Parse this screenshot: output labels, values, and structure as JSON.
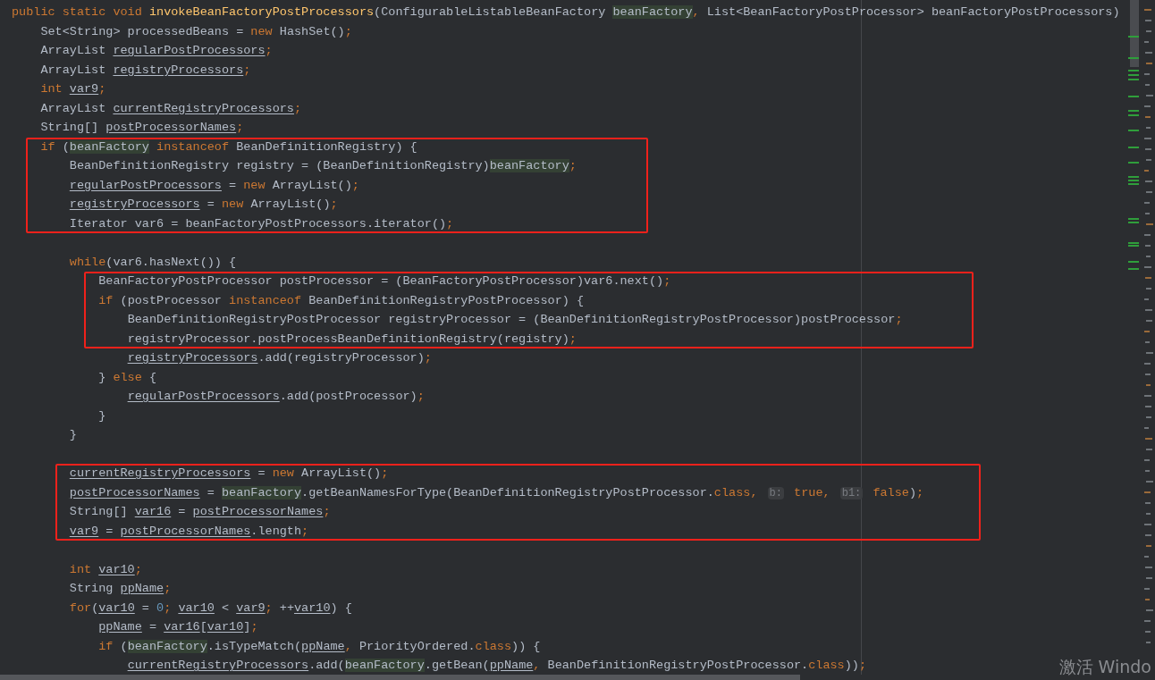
{
  "editor": {
    "blocks": [
      {
        "highlighted": false,
        "lines": [
          {
            "kind": "code",
            "tokens": [
              {
                "text": "public static void ",
                "kind": "keyword"
              },
              {
                "text": "invokeBeanFactoryPostProcessors",
                "kind": "method"
              },
              {
                "text": "(ConfigurableListableBeanFactory ",
                "kind": "plain"
              },
              {
                "text": "beanFactory",
                "kind": "param"
              },
              {
                "text": ", ",
                "kind": "keyword"
              },
              {
                "text": "List<BeanFactoryPostProcessor> beanFactoryPostProcessors)",
                "kind": "plain"
              }
            ]
          },
          {
            "kind": "code",
            "tokens": [
              {
                "text": "    Set<String> processedBeans = ",
                "kind": "plain"
              },
              {
                "text": "new",
                "kind": "keyword"
              },
              {
                "text": " HashSet()",
                "kind": "plain"
              },
              {
                "text": ";",
                "kind": "keyword"
              }
            ]
          },
          {
            "kind": "code",
            "tokens": [
              {
                "text": "    ArrayList ",
                "kind": "plain"
              },
              {
                "text": "regularPostProcessors",
                "kind": "field"
              },
              {
                "text": ";",
                "kind": "keyword"
              }
            ]
          },
          {
            "kind": "code",
            "tokens": [
              {
                "text": "    ArrayList ",
                "kind": "plain"
              },
              {
                "text": "registryProcessors",
                "kind": "field"
              },
              {
                "text": ";",
                "kind": "keyword"
              }
            ]
          },
          {
            "kind": "code",
            "tokens": [
              {
                "text": "    int ",
                "kind": "keyword"
              },
              {
                "text": "var9",
                "kind": "field"
              },
              {
                "text": ";",
                "kind": "keyword"
              }
            ]
          },
          {
            "kind": "code",
            "tokens": [
              {
                "text": "    ArrayList ",
                "kind": "plain"
              },
              {
                "text": "currentRegistryProcessors",
                "kind": "field"
              },
              {
                "text": ";",
                "kind": "keyword"
              }
            ]
          },
          {
            "kind": "code",
            "tokens": [
              {
                "text": "    String[] ",
                "kind": "plain"
              },
              {
                "text": "postProcessorNames",
                "kind": "field"
              },
              {
                "text": ";",
                "kind": "keyword"
              }
            ]
          }
        ]
      },
      {
        "highlighted": true,
        "lines": [
          {
            "kind": "code",
            "tokens": [
              {
                "text": "    if",
                "kind": "keyword"
              },
              {
                "text": " (",
                "kind": "plain"
              },
              {
                "text": "beanFactory",
                "kind": "param"
              },
              {
                "text": " instanceof",
                "kind": "keyword"
              },
              {
                "text": " BeanDefinitionRegistry) {",
                "kind": "plain"
              }
            ]
          },
          {
            "kind": "code",
            "tokens": [
              {
                "text": "        BeanDefinitionRegistry registry = (BeanDefinitionRegistry)",
                "kind": "plain"
              },
              {
                "text": "beanFactory",
                "kind": "param"
              },
              {
                "text": ";",
                "kind": "keyword"
              }
            ]
          },
          {
            "kind": "code",
            "tokens": [
              {
                "text": "        regularPostProcessors",
                "kind": "field"
              },
              {
                "text": " = ",
                "kind": "plain"
              },
              {
                "text": "new",
                "kind": "keyword"
              },
              {
                "text": " ArrayList()",
                "kind": "plain"
              },
              {
                "text": ";",
                "kind": "keyword"
              }
            ]
          },
          {
            "kind": "code",
            "tokens": [
              {
                "text": "        registryProcessors",
                "kind": "field"
              },
              {
                "text": " = ",
                "kind": "plain"
              },
              {
                "text": "new",
                "kind": "keyword"
              },
              {
                "text": " ArrayList()",
                "kind": "plain"
              },
              {
                "text": ";",
                "kind": "keyword"
              }
            ]
          },
          {
            "kind": "code",
            "tokens": [
              {
                "text": "        Iterator var6 = beanFactoryPostProcessors.iterator()",
                "kind": "plain"
              },
              {
                "text": ";",
                "kind": "keyword"
              }
            ]
          }
        ]
      },
      {
        "highlighted": false,
        "lines": [
          {
            "kind": "blank"
          },
          {
            "kind": "code",
            "tokens": [
              {
                "text": "        while",
                "kind": "keyword"
              },
              {
                "text": "(var6.hasNext()) {",
                "kind": "plain"
              }
            ]
          }
        ]
      },
      {
        "highlighted": true,
        "lines": [
          {
            "kind": "code",
            "tokens": [
              {
                "text": "            BeanFactoryPostProcessor postProcessor = (BeanFactoryPostProcessor)var6.next()",
                "kind": "plain"
              },
              {
                "text": ";",
                "kind": "keyword"
              }
            ]
          },
          {
            "kind": "code",
            "tokens": [
              {
                "text": "            if",
                "kind": "keyword"
              },
              {
                "text": " (postProcessor ",
                "kind": "plain"
              },
              {
                "text": "instanceof",
                "kind": "keyword"
              },
              {
                "text": " BeanDefinitionRegistryPostProcessor) {",
                "kind": "plain"
              }
            ]
          },
          {
            "kind": "code",
            "tokens": [
              {
                "text": "                BeanDefinitionRegistryPostProcessor registryProcessor = (BeanDefinitionRegistryPostProcessor)postProcessor",
                "kind": "plain"
              },
              {
                "text": ";",
                "kind": "keyword"
              }
            ]
          },
          {
            "kind": "code",
            "tokens": [
              {
                "text": "                registryProcessor.postProcessBeanDefinitionRegistry(registry)",
                "kind": "plain"
              },
              {
                "text": ";",
                "kind": "keyword"
              }
            ]
          }
        ]
      },
      {
        "highlighted": false,
        "lines": [
          {
            "kind": "code",
            "tokens": [
              {
                "text": "                registryProcessors",
                "kind": "field"
              },
              {
                "text": ".add(registryProcessor)",
                "kind": "plain"
              },
              {
                "text": ";",
                "kind": "keyword"
              }
            ]
          },
          {
            "kind": "code",
            "tokens": [
              {
                "text": "            } ",
                "kind": "plain"
              },
              {
                "text": "else",
                "kind": "keyword"
              },
              {
                "text": " {",
                "kind": "plain"
              }
            ]
          },
          {
            "kind": "code",
            "tokens": [
              {
                "text": "                regularPostProcessors",
                "kind": "field"
              },
              {
                "text": ".add(postProcessor)",
                "kind": "plain"
              },
              {
                "text": ";",
                "kind": "keyword"
              }
            ]
          },
          {
            "kind": "code",
            "tokens": [
              {
                "text": "            }",
                "kind": "plain"
              }
            ]
          },
          {
            "kind": "code",
            "tokens": [
              {
                "text": "        }",
                "kind": "plain"
              }
            ]
          },
          {
            "kind": "blank"
          }
        ]
      },
      {
        "highlighted": true,
        "lines": [
          {
            "kind": "code",
            "tokens": [
              {
                "text": "        currentRegistryProcessors",
                "kind": "field"
              },
              {
                "text": " = ",
                "kind": "plain"
              },
              {
                "text": "new",
                "kind": "keyword"
              },
              {
                "text": " ArrayList()",
                "kind": "plain"
              },
              {
                "text": ";",
                "kind": "keyword"
              }
            ]
          },
          {
            "kind": "code",
            "tokens": [
              {
                "text": "        postProcessorNames",
                "kind": "field"
              },
              {
                "text": " = ",
                "kind": "plain"
              },
              {
                "text": "beanFactory",
                "kind": "param"
              },
              {
                "text": ".getBeanNamesForType(BeanDefinitionRegistryPostProcessor.",
                "kind": "plain"
              },
              {
                "text": "class",
                "kind": "keyword"
              },
              {
                "text": ", ",
                "kind": "keyword"
              },
              {
                "text": "b:",
                "kind": "hint"
              },
              {
                "text": " true",
                "kind": "keyword"
              },
              {
                "text": ", ",
                "kind": "keyword"
              },
              {
                "text": "b1:",
                "kind": "hint"
              },
              {
                "text": " false",
                "kind": "keyword"
              },
              {
                "text": ")",
                "kind": "plain"
              },
              {
                "text": ";",
                "kind": "keyword"
              }
            ]
          },
          {
            "kind": "code",
            "tokens": [
              {
                "text": "        String[] ",
                "kind": "plain"
              },
              {
                "text": "var16",
                "kind": "field"
              },
              {
                "text": " = ",
                "kind": "plain"
              },
              {
                "text": "postProcessorNames",
                "kind": "field"
              },
              {
                "text": ";",
                "kind": "keyword"
              }
            ]
          },
          {
            "kind": "code",
            "tokens": [
              {
                "text": "        var9",
                "kind": "field"
              },
              {
                "text": " = ",
                "kind": "plain"
              },
              {
                "text": "postProcessorNames",
                "kind": "field"
              },
              {
                "text": ".length",
                "kind": "plain"
              },
              {
                "text": ";",
                "kind": "keyword"
              }
            ]
          }
        ]
      },
      {
        "highlighted": false,
        "lines": [
          {
            "kind": "blank"
          },
          {
            "kind": "code",
            "tokens": [
              {
                "text": "        int ",
                "kind": "keyword"
              },
              {
                "text": "var10",
                "kind": "field"
              },
              {
                "text": ";",
                "kind": "keyword"
              }
            ]
          },
          {
            "kind": "code",
            "tokens": [
              {
                "text": "        String ",
                "kind": "plain"
              },
              {
                "text": "ppName",
                "kind": "field"
              },
              {
                "text": ";",
                "kind": "keyword"
              }
            ]
          },
          {
            "kind": "code",
            "tokens": [
              {
                "text": "        for",
                "kind": "keyword"
              },
              {
                "text": "(",
                "kind": "plain"
              },
              {
                "text": "var10",
                "kind": "field"
              },
              {
                "text": " = ",
                "kind": "plain"
              },
              {
                "text": "0",
                "kind": "number"
              },
              {
                "text": "; ",
                "kind": "keyword"
              },
              {
                "text": "var10",
                "kind": "field"
              },
              {
                "text": " < ",
                "kind": "plain"
              },
              {
                "text": "var9",
                "kind": "field"
              },
              {
                "text": "; ",
                "kind": "keyword"
              },
              {
                "text": "++",
                "kind": "plain"
              },
              {
                "text": "var10",
                "kind": "field"
              },
              {
                "text": ") {",
                "kind": "plain"
              }
            ]
          },
          {
            "kind": "code",
            "tokens": [
              {
                "text": "            ppName",
                "kind": "field"
              },
              {
                "text": " = ",
                "kind": "plain"
              },
              {
                "text": "var16",
                "kind": "field"
              },
              {
                "text": "[",
                "kind": "plain"
              },
              {
                "text": "var10",
                "kind": "field"
              },
              {
                "text": "]",
                "kind": "plain"
              },
              {
                "text": ";",
                "kind": "keyword"
              }
            ]
          },
          {
            "kind": "code",
            "tokens": [
              {
                "text": "            if",
                "kind": "keyword"
              },
              {
                "text": " (",
                "kind": "plain"
              },
              {
                "text": "beanFactory",
                "kind": "param"
              },
              {
                "text": ".isTypeMatch(",
                "kind": "plain"
              },
              {
                "text": "ppName",
                "kind": "field"
              },
              {
                "text": ", ",
                "kind": "keyword"
              },
              {
                "text": "PriorityOrdered.",
                "kind": "plain"
              },
              {
                "text": "class",
                "kind": "keyword"
              },
              {
                "text": ")) {",
                "kind": "plain"
              }
            ]
          },
          {
            "kind": "code",
            "tokens": [
              {
                "text": "                currentRegistryProcessors",
                "kind": "field"
              },
              {
                "text": ".add(",
                "kind": "plain"
              },
              {
                "text": "beanFactory",
                "kind": "param"
              },
              {
                "text": ".getBean(",
                "kind": "plain"
              },
              {
                "text": "ppName",
                "kind": "field"
              },
              {
                "text": ", ",
                "kind": "keyword"
              },
              {
                "text": "BeanDefinitionRegistryPostProcessor.",
                "kind": "plain"
              },
              {
                "text": "class",
                "kind": "keyword"
              },
              {
                "text": "))",
                "kind": "plain"
              },
              {
                "text": ";",
                "kind": "keyword"
              }
            ]
          }
        ]
      }
    ]
  },
  "watermark_text": "激活 Windo"
}
